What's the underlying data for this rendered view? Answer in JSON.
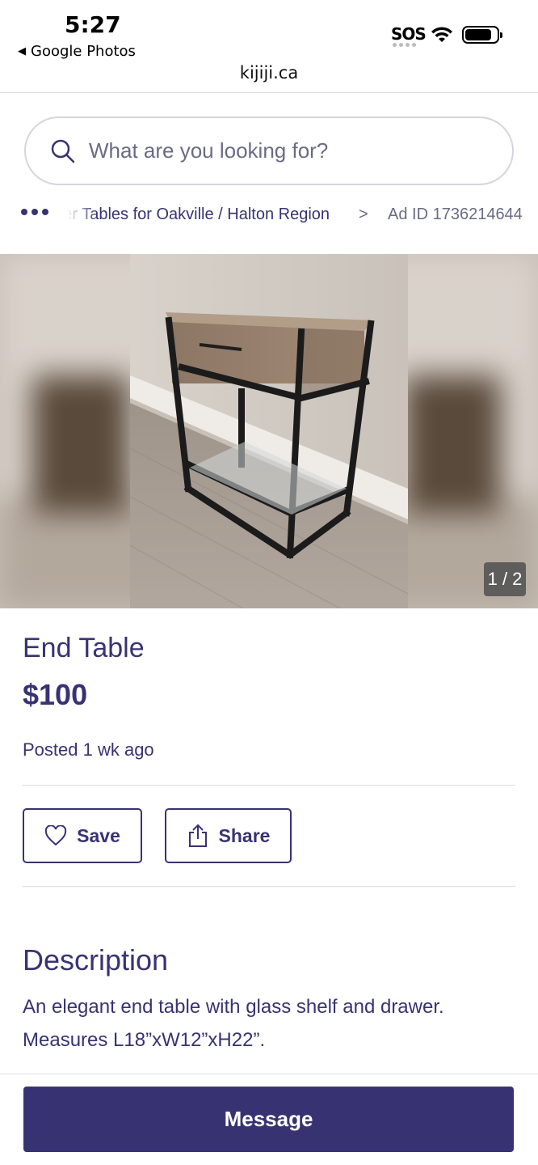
{
  "status_bar": {
    "time": "5:27",
    "back_app": "Google Photos",
    "sos": "SOS"
  },
  "browser": {
    "url": "kijiji.ca"
  },
  "search": {
    "placeholder": "What are you looking for?"
  },
  "breadcrumb": {
    "link": "Other Tables for Oakville / Halton Region",
    "ad_id": "Ad ID 1736214644"
  },
  "gallery": {
    "counter": "1 / 2"
  },
  "listing": {
    "title": "End Table",
    "price": "$100",
    "posted": "Posted 1 wk ago"
  },
  "actions": {
    "save": "Save",
    "share": "Share"
  },
  "description": {
    "heading": "Description",
    "line1": "An elegant end table with glass shelf and drawer.",
    "line2": "Measures L18”xW12”xH22”."
  },
  "bottom": {
    "message": "Message"
  },
  "colors": {
    "brand": "#373373",
    "muted": "#6b6a86",
    "divider": "#dcdcdc"
  }
}
